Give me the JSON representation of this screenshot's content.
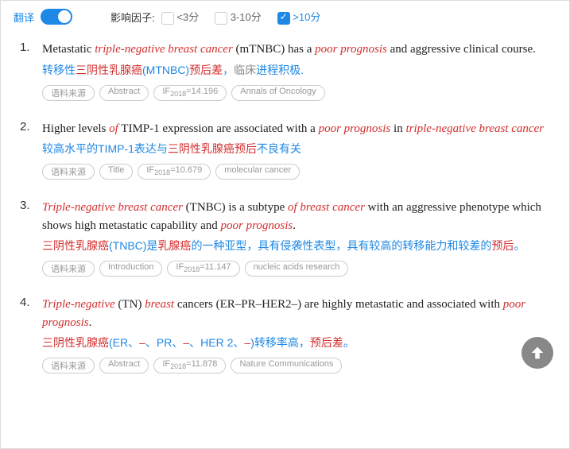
{
  "topbar": {
    "translate_label": "翻译",
    "factor_label": "影响因子:",
    "options": [
      {
        "label": "<3分",
        "checked": false
      },
      {
        "label": "3-10分",
        "checked": false
      },
      {
        "label": ">10分",
        "checked": true
      }
    ]
  },
  "tags_common": {
    "source": "语料来源"
  },
  "results": [
    {
      "num": "1.",
      "eng_parts": [
        "Metastatic ",
        "triple-negative breast cancer",
        " (mTNBC) has a ",
        "poor prognosis",
        " and aggressive clinical course."
      ],
      "eng_hl": [
        1,
        3
      ],
      "chn": "转移性<r>三阴性乳腺癌</r>(MTNBC)<r>预后差</r>，<g>临床</g>进程积极.",
      "tags": [
        "Abstract",
        "IF₂₀₁₈=14.196",
        "Annals of Oncology"
      ]
    },
    {
      "num": "2.",
      "eng_parts": [
        "Higher levels ",
        "of",
        " TIMP-1 expression are associated with a ",
        "poor prognosis",
        " in ",
        "triple-negative breast cancer"
      ],
      "eng_hl": [
        1,
        3,
        5
      ],
      "chn": "较高水平的TIMP-1表达与<r>三阴性乳腺癌预后</r>不良有关",
      "tags": [
        "Title",
        "IF₂₀₁₈=10.679",
        "molecular cancer"
      ]
    },
    {
      "num": "3.",
      "eng_parts": [
        "Triple-negative breast cancer",
        " (TNBC) is a subtype ",
        "of breast cancer",
        " with an aggressive phenotype which shows high metastatic capability and ",
        "poor prognosis",
        "."
      ],
      "eng_hl": [
        0,
        2,
        4
      ],
      "chn": "<r>三阴性乳腺癌</r>(TNBC)是<r>乳腺癌</r>的一种亚型，具有侵袭性表型，具有较高的转移能力和较差的<r>预后</r>。",
      "tags": [
        "Introduction",
        "IF₂₀₁₈=11.147",
        "nucleic acids research"
      ]
    },
    {
      "num": "4.",
      "eng_parts": [
        "Triple-negative",
        " (TN) ",
        "breast",
        " cancers (ER–PR–HER2–) are highly metastatic and associated with ",
        "poor prognosis",
        "."
      ],
      "eng_hl": [
        0,
        2,
        4
      ],
      "chn": "<r>三阴性乳腺癌</r>(ER、<r>–</r>、PR、<r>–</r>、HER 2、<r>–</r>)转移率高，<r>预后差</r>。",
      "tags": [
        "Abstract",
        "IF₂₀₁₈=11.878",
        "Nature Communications"
      ]
    }
  ]
}
